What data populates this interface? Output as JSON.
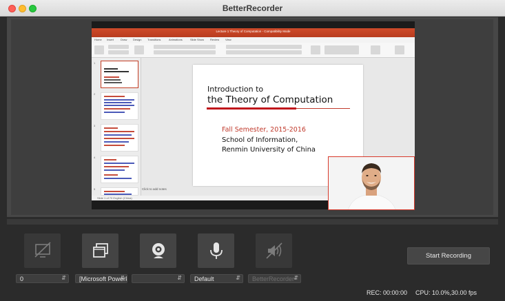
{
  "app": {
    "title": "BetterRecorder"
  },
  "window": {
    "close": "close",
    "minimize": "minimize",
    "maximize": "maximize"
  },
  "preview": {
    "document_title": "Lecture 1 Theory of Computation - Compatibility Mode",
    "ribbon_tabs": [
      "Home",
      "Insert",
      "Draw",
      "Design",
      "Transitions",
      "Animations",
      "Slide Show",
      "Review",
      "View"
    ],
    "slide": {
      "title_line1": "Introduction to",
      "title_line2": "the Theory of Computation",
      "subtitle_red": "Fall Semester, 2015-2016",
      "body_line1": "School of Information,",
      "body_line2": "Renmin University of China"
    },
    "thumbnail_numbers": [
      "1",
      "2",
      "3",
      "4",
      "5"
    ],
    "notes_placeholder": "Click to add notes",
    "status": "Slide 1 of 70   English (China)"
  },
  "controls": {
    "sources": [
      {
        "name": "screen-source",
        "icon": "screen-off-icon"
      },
      {
        "name": "window-source",
        "icon": "windows-icon"
      },
      {
        "name": "webcam-source",
        "icon": "webcam-icon"
      },
      {
        "name": "microphone-source",
        "icon": "microphone-icon"
      },
      {
        "name": "system-audio-source",
        "icon": "speaker-muted-icon"
      }
    ],
    "selects": {
      "screen": "0",
      "window": "[Microsoft PowerPoint]",
      "webcam": "",
      "microphone": "Default",
      "system_audio": "BetterRecorder"
    },
    "start_label": "Start Recording",
    "rec_time": "REC: 00:00:00",
    "cpu_fps": "CPU: 10.0%,30.00 fps"
  },
  "colors": {
    "accent_red": "#c0392b",
    "background": "#2b2b2b",
    "ribbon": "#c5442a"
  }
}
